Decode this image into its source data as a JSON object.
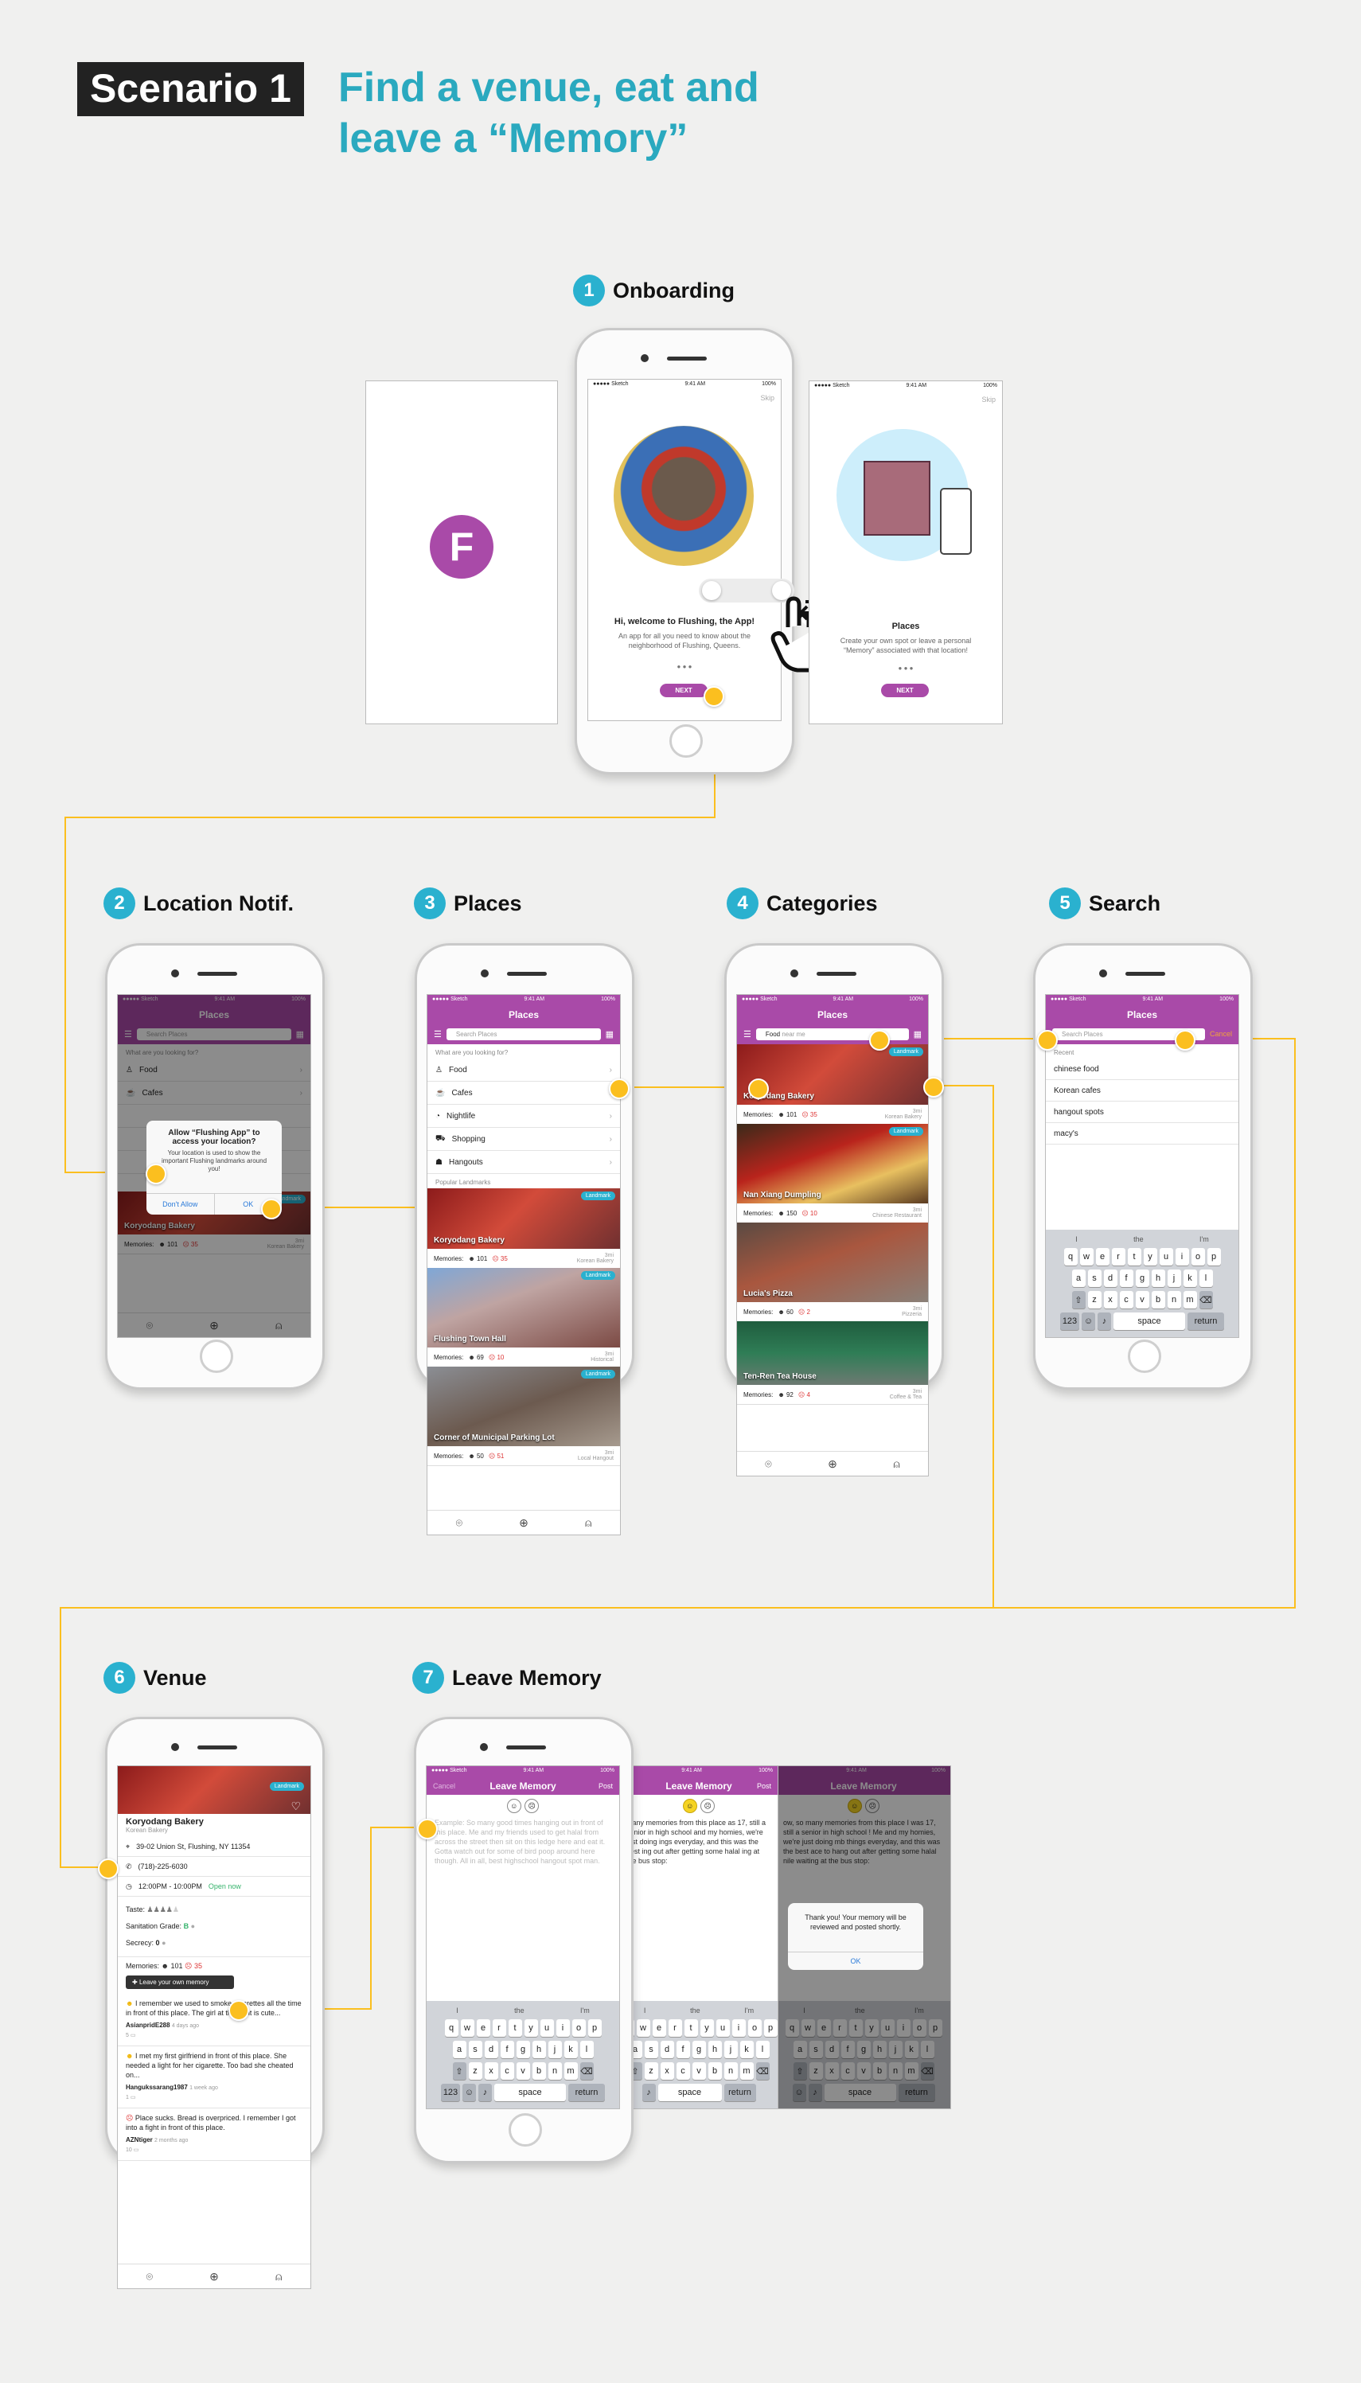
{
  "header": {
    "scenario": "Scenario 1",
    "title_line1": "Find a venue, eat and",
    "title_line2": "leave a “Memory”"
  },
  "steps": [
    {
      "num": "1",
      "label": "Onboarding"
    },
    {
      "num": "2",
      "label": "Location Notif."
    },
    {
      "num": "3",
      "label": "Places"
    },
    {
      "num": "4",
      "label": "Categories"
    },
    {
      "num": "5",
      "label": "Search"
    },
    {
      "num": "6",
      "label": "Venue"
    },
    {
      "num": "7",
      "label": "Leave Memory"
    }
  ],
  "status": {
    "carrier": "●●●●● Sketch",
    "time": "9:41 AM",
    "battery": "100%"
  },
  "colors": {
    "accent": "#a94aa8",
    "teal": "#2ab1cf",
    "connector": "#fbbf1f"
  },
  "onboarding": {
    "skip": "Skip",
    "welcome_title": "Hi, welcome to Flushing, the App!",
    "welcome_body": "An app for all you need to know about the neighborhood of Flushing, Queens.",
    "next": "NEXT",
    "places_title": "Places",
    "places_body": "Create your own spot or leave a personal “Memory” associated with that location!",
    "logo_letter": "F",
    "gesture_icon": "swipe-hand-icon"
  },
  "places_screen": {
    "title": "Places",
    "search_placeholder": "Search Places",
    "looking_for": "What are you looking for?",
    "categories": [
      "Food",
      "Cafes",
      "Nightlife",
      "Shopping",
      "Hangouts"
    ],
    "popular": "Popular Landmarks",
    "memories_label": "Memories:",
    "landmarks": [
      {
        "name": "Koryodang Bakery",
        "badge": "Landmark",
        "likes": "101",
        "dislikes": "35",
        "dist": "3mi",
        "kind": "Korean Bakery"
      },
      {
        "name": "Flushing Town Hall",
        "badge": "Landmark",
        "likes": "69",
        "dislikes": "10",
        "dist": "3mi",
        "kind": "Historical"
      },
      {
        "name": "Corner of Municipal Parking Lot",
        "badge": "Landmark",
        "likes": "50",
        "dislikes": "51",
        "dist": "3mi",
        "kind": "Local Hangout"
      }
    ]
  },
  "location_dialog": {
    "title": "Allow “Flushing App” to access your location?",
    "body": "Your location is used to show the important Flushing landmarks around you!",
    "deny": "Don't Allow",
    "ok": "OK",
    "bg_items": [
      "Food",
      "Cafes"
    ],
    "bg_card": {
      "name": "Koryodang Bakery",
      "likes": "101",
      "dislikes": "35",
      "dist": "3mi",
      "kind": "Korean Bakery"
    }
  },
  "categories_screen": {
    "title": "Places",
    "search_text": "Food",
    "search_hint": "near me",
    "results": [
      {
        "name": "Koryodang Bakery",
        "likes": "101",
        "dislikes": "35",
        "dist": "3mi",
        "kind": "Korean Bakery"
      },
      {
        "name": "Nan Xiang Dumpling",
        "likes": "150",
        "dislikes": "10",
        "dist": "3mi",
        "kind": "Chinese Restaurant"
      },
      {
        "name": "Lucia's Pizza",
        "likes": "60",
        "dislikes": "2",
        "dist": "3mi",
        "kind": "Pizzeria"
      },
      {
        "name": "Ten-Ren Tea House",
        "likes": "92",
        "dislikes": "4",
        "dist": "3mi",
        "kind": "Coffee & Tea"
      }
    ]
  },
  "search_screen": {
    "title": "Places",
    "placeholder": "Search Places",
    "cancel": "Cancel",
    "recent_label": "Recent",
    "recent": [
      "chinese food",
      "Korean cafes",
      "hangout spots",
      "macy's"
    ]
  },
  "keyboard": {
    "suggestions": [
      "I",
      "the",
      "I'm"
    ],
    "row1": [
      "q",
      "w",
      "e",
      "r",
      "t",
      "y",
      "u",
      "i",
      "o",
      "p"
    ],
    "row2": [
      "a",
      "s",
      "d",
      "f",
      "g",
      "h",
      "j",
      "k",
      "l"
    ],
    "row3": [
      "z",
      "x",
      "c",
      "v",
      "b",
      "n",
      "m"
    ],
    "num": "123",
    "space": "space",
    "return": "return"
  },
  "venue": {
    "name": "Koryodang Bakery",
    "kind": "Korean Bakery",
    "badge": "Landmark",
    "address": "39-02 Union St, Flushing, NY 11354",
    "phone": "(718)-225-6030",
    "hours": "12:00PM - 10:00PM",
    "open": "Open now",
    "taste": "Taste:",
    "taste_rating": 4,
    "sanitation": "Sanitation Grade:",
    "sanitation_grade": "B",
    "secrecy": "Secrecy:",
    "secrecy_value": "0",
    "memories_label": "Memories:",
    "likes": "101",
    "dislikes": "35",
    "leave_button": "Leave your own memory",
    "comments": [
      {
        "text": "I remember we used to smoke cigarettes all the time in front of this place. The girl at the front is cute...",
        "user": "AsianpridE288",
        "time": "4 days ago",
        "count": "5"
      },
      {
        "text": "I met my first girlfriend in front of this place. She needed a light for her cigarette. Too bad she cheated on...",
        "user": "Hangukssarang1987",
        "time": "1 week ago",
        "count": "1"
      },
      {
        "text": "Place sucks. Bread is overpriced. I remember I got into a fight in front of this place.",
        "user": "AZNtiger",
        "time": "2 months ago",
        "count": "10"
      }
    ]
  },
  "memory": {
    "cancel": "Cancel",
    "title": "Leave Memory",
    "post": "Post",
    "placeholder": "Example: So many good times hanging out in front of this place. Me and my friends used to get halal from across the street then sit on this ledge here and eat it. Gotta watch out for some of bird poop around here though. All in all, best highschool hangout spot man.",
    "typed": "many memories from this place as 17, still a senior in high school and my homies, we're just doing ings everyday, and this was the best ing out after getting some halal ing at the bus stop:",
    "typed3": "ow, so many memories from this place I was 17, still a senior in high school ! Me and my homies, we're just doing mb things everyday, and this was the best ace to hang out after getting some halal nile waiting at the bus stop:",
    "thanks": "Thank you! Your memory will be reviewed and posted shortly.",
    "ok": "OK"
  }
}
